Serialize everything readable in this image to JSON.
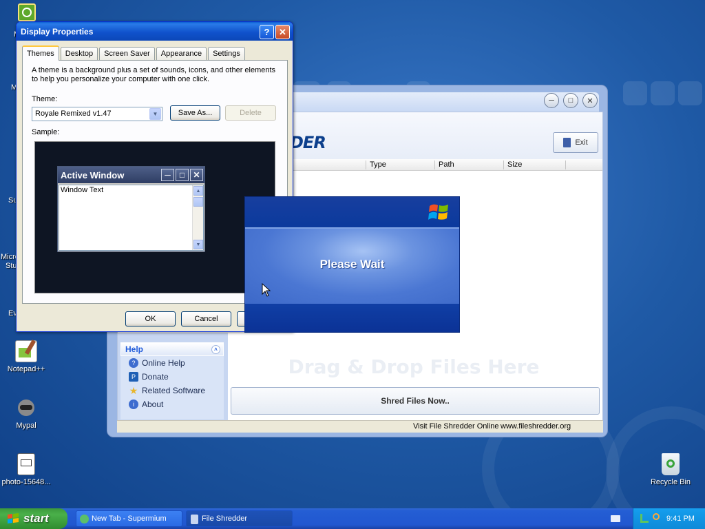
{
  "desktop": {
    "icons": [
      {
        "label": "Notepad++"
      },
      {
        "label": "Mypal"
      },
      {
        "label": "photo-15648..."
      },
      {
        "label": "Recycle Bin"
      }
    ],
    "partial_labels": [
      "M",
      "M",
      "Su",
      "Micro",
      "Stu",
      "Ev"
    ]
  },
  "display_properties": {
    "title": "Display Properties",
    "tabs": [
      "Themes",
      "Desktop",
      "Screen Saver",
      "Appearance",
      "Settings"
    ],
    "active_tab": "Themes",
    "description": "A theme is a background plus a set of sounds, icons, and other elements to help you personalize your computer with one click.",
    "theme_label": "Theme:",
    "theme_value": "Royale Remixed v1.47",
    "save_as_label": "Save As...",
    "delete_label": "Delete",
    "sample_label": "Sample:",
    "sample_window": {
      "title": "Active Window",
      "text": "Window Text"
    },
    "ok_label": "OK",
    "cancel_label": "Cancel"
  },
  "file_shredder": {
    "brand_fragment": "DER",
    "exit_label": "Exit",
    "columns": [
      "Type",
      "Path",
      "Size"
    ],
    "help_panel": {
      "title": "Help",
      "items": [
        "Online Help",
        "Donate",
        "Related Software",
        "About"
      ]
    },
    "drop_hint": "Drag & Drop Files Here",
    "shred_button": "Shred Files Now..",
    "status_left": "Visit File Shredder Online",
    "status_right": "www.fileshredder.org"
  },
  "please_wait": {
    "text": "Please Wait"
  },
  "taskbar": {
    "start_label": "start",
    "items": [
      "New Tab - Supermium",
      "File Shredder"
    ],
    "clock": "9:41 PM"
  },
  "colors": {
    "xp_title_blue": "#0b47b8",
    "start_green": "#3c9a3c",
    "tray_blue": "#0e8ad9",
    "help_blue": "#245edb"
  }
}
